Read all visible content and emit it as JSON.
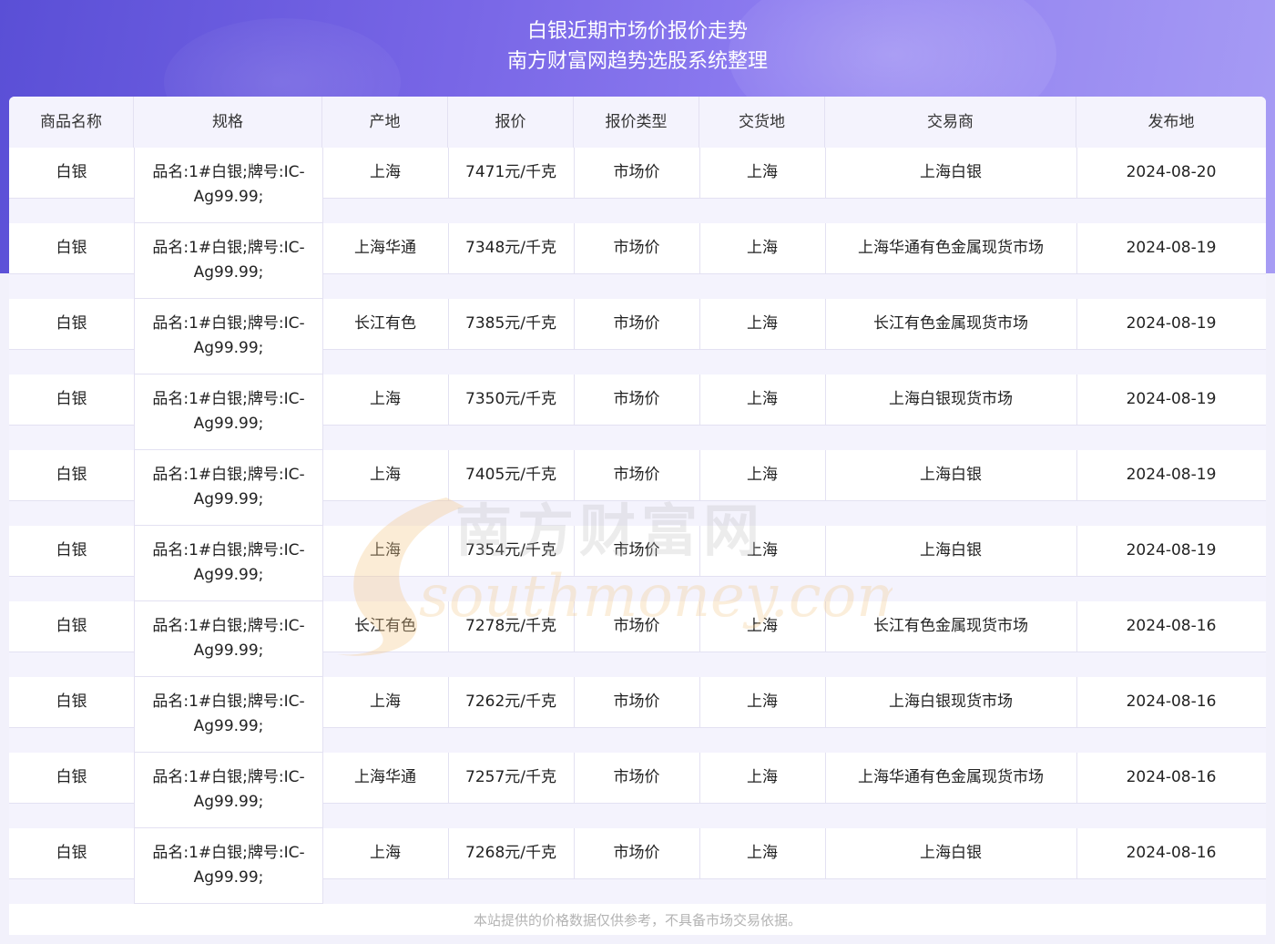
{
  "title": {
    "line1": "白银近期市场价报价走势",
    "line2": "南方财富网趋势选股系统整理"
  },
  "table": {
    "columns": [
      "商品名称",
      "规格",
      "产地",
      "报价",
      "报价类型",
      "交货地",
      "交易商",
      "发布地"
    ],
    "rows": [
      {
        "name": "白银",
        "spec1": "品名:1#白银;牌号:IC-",
        "spec2": "Ag99.99;",
        "origin": "上海",
        "price": "7471元/千克",
        "type": "市场价",
        "delivery": "上海",
        "trader": "上海白银",
        "date": "2024-08-20"
      },
      {
        "name": "白银",
        "spec1": "品名:1#白银;牌号:IC-",
        "spec2": "Ag99.99;",
        "origin": "上海华通",
        "price": "7348元/千克",
        "type": "市场价",
        "delivery": "上海",
        "trader": "上海华通有色金属现货市场",
        "date": "2024-08-19"
      },
      {
        "name": "白银",
        "spec1": "品名:1#白银;牌号:IC-",
        "spec2": "Ag99.99;",
        "origin": "长江有色",
        "price": "7385元/千克",
        "type": "市场价",
        "delivery": "上海",
        "trader": "长江有色金属现货市场",
        "date": "2024-08-19"
      },
      {
        "name": "白银",
        "spec1": "品名:1#白银;牌号:IC-",
        "spec2": "Ag99.99;",
        "origin": "上海",
        "price": "7350元/千克",
        "type": "市场价",
        "delivery": "上海",
        "trader": "上海白银现货市场",
        "date": "2024-08-19"
      },
      {
        "name": "白银",
        "spec1": "品名:1#白银;牌号:IC-",
        "spec2": "Ag99.99;",
        "origin": "上海",
        "price": "7405元/千克",
        "type": "市场价",
        "delivery": "上海",
        "trader": "上海白银",
        "date": "2024-08-19"
      },
      {
        "name": "白银",
        "spec1": "品名:1#白银;牌号:IC-",
        "spec2": "Ag99.99;",
        "origin": "上海",
        "price": "7354元/千克",
        "type": "市场价",
        "delivery": "上海",
        "trader": "上海白银",
        "date": "2024-08-19"
      },
      {
        "name": "白银",
        "spec1": "品名:1#白银;牌号:IC-",
        "spec2": "Ag99.99;",
        "origin": "长江有色",
        "price": "7278元/千克",
        "type": "市场价",
        "delivery": "上海",
        "trader": "长江有色金属现货市场",
        "date": "2024-08-16"
      },
      {
        "name": "白银",
        "spec1": "品名:1#白银;牌号:IC-",
        "spec2": "Ag99.99;",
        "origin": "上海",
        "price": "7262元/千克",
        "type": "市场价",
        "delivery": "上海",
        "trader": "上海白银现货市场",
        "date": "2024-08-16"
      },
      {
        "name": "白银",
        "spec1": "品名:1#白银;牌号:IC-",
        "spec2": "Ag99.99;",
        "origin": "上海华通",
        "price": "7257元/千克",
        "type": "市场价",
        "delivery": "上海",
        "trader": "上海华通有色金属现货市场",
        "date": "2024-08-16"
      },
      {
        "name": "白银",
        "spec1": "品名:1#白银;牌号:IC-",
        "spec2": "Ag99.99;",
        "origin": "上海",
        "price": "7268元/千克",
        "type": "市场价",
        "delivery": "上海",
        "trader": "上海白银",
        "date": "2024-08-16"
      }
    ]
  },
  "footer": "本站提供的价格数据仅供参考，不具备市场交易依据。",
  "watermark": {
    "cn": "南方财富网",
    "en": "southmoney.com"
  },
  "colors": {
    "banner_start": "#5a4fd6",
    "banner_end": "#a79cf4",
    "header_bg": "#f4f3fd",
    "grid": "#e3e1f2",
    "watermark_orange": "#f3c98a",
    "watermark_gray": "#bdbdbd"
  }
}
